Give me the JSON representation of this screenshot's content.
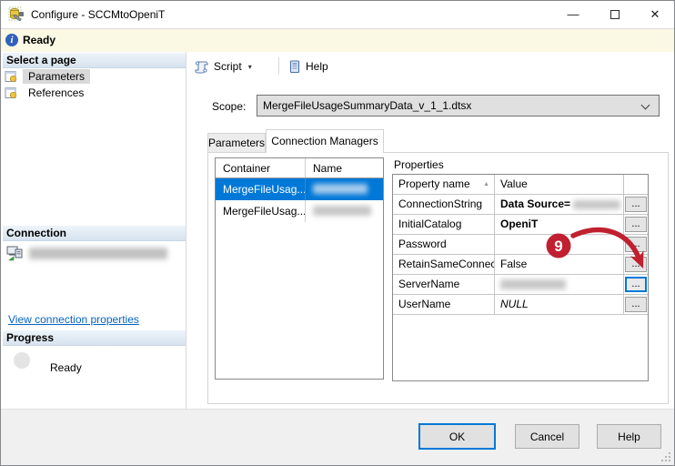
{
  "window": {
    "title": "Configure - SCCMtoOpeniT",
    "status_bar": {
      "text": "Ready"
    },
    "controls": {
      "minimize_glyph": "—",
      "close_glyph": "✕"
    }
  },
  "sidebar": {
    "select_page": {
      "title": "Select a page",
      "items": [
        {
          "label": "Parameters",
          "selected": true
        },
        {
          "label": "References",
          "selected": false
        }
      ]
    },
    "connection": {
      "title": "Connection",
      "server_redacted": true,
      "link": "View connection properties"
    },
    "progress": {
      "title": "Progress",
      "status": "Ready"
    }
  },
  "toolbar": {
    "script_label": "Script",
    "help_label": "Help",
    "dropdown_glyph": "▾"
  },
  "scope": {
    "label": "Scope:",
    "value": "MergeFileUsageSummaryData_v_1_1.dtsx"
  },
  "tabs": [
    {
      "label": "Parameters",
      "active": false
    },
    {
      "label": "Connection Managers",
      "active": true
    }
  ],
  "container_table": {
    "columns": [
      "Container",
      "Name"
    ],
    "rows": [
      {
        "container": "MergeFileUsag...",
        "name_redacted": true,
        "selected": true
      },
      {
        "container": "MergeFileUsag...",
        "name_redacted": true,
        "selected": false
      }
    ]
  },
  "properties": {
    "title": "Properties",
    "columns": [
      "Property name",
      "Value"
    ],
    "sort_glyph": "▲",
    "ellipsis": "...",
    "rows": [
      {
        "name": "ConnectionString",
        "value": "Data Source=",
        "value_bold": true,
        "value_redacted_suffix": true
      },
      {
        "name": "InitialCatalog",
        "value": "OpeniT",
        "value_bold": true
      },
      {
        "name": "Password",
        "value": ""
      },
      {
        "name": "RetainSameConnec...",
        "value": "False"
      },
      {
        "name": "ServerName",
        "value": "",
        "value_redacted": true,
        "button_focused": true
      },
      {
        "name": "UserName",
        "value": "NULL",
        "value_italic": true
      }
    ]
  },
  "annotation": {
    "number": "9",
    "color": "#c0202f"
  },
  "footer": {
    "ok_label": "OK",
    "cancel_label": "Cancel",
    "help_label": "Help"
  },
  "colors": {
    "accent": "#0078d7",
    "selection_bg": "#0078d7",
    "link": "#0563c1",
    "status_bar_bg": "#fbf9e3",
    "annotation_red": "#c0202f"
  }
}
